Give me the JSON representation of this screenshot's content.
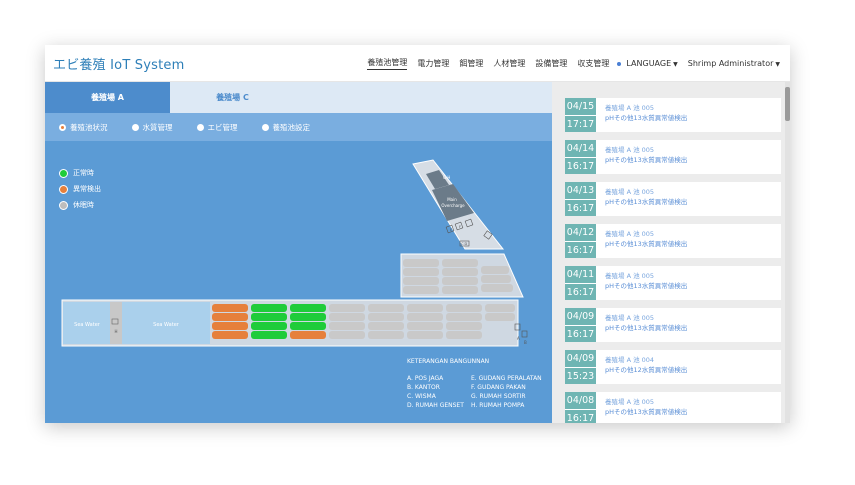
{
  "header": {
    "title": "エビ養殖 IoT System",
    "nav": [
      "養殖池管理",
      "電力管理",
      "餌管理",
      "人材管理",
      "設備管理",
      "収支管理"
    ],
    "active_nav": "養殖池管理",
    "language": "LANGUAGE",
    "user": "Shrimp Administrator"
  },
  "tabs": [
    {
      "label": "養殖場 A",
      "active": true
    },
    {
      "label": "養殖場 C",
      "active": false
    }
  ],
  "radios": [
    {
      "label": "養殖池状況",
      "selected": true
    },
    {
      "label": "水質管理",
      "selected": false
    },
    {
      "label": "エビ管理",
      "selected": false
    },
    {
      "label": "養殖池設定",
      "selected": false
    }
  ],
  "legend": [
    {
      "label": "正常時",
      "color": "#1fcc3a"
    },
    {
      "label": "異常検出",
      "color": "#e6803c"
    },
    {
      "label": "休眠時",
      "color": "#bdbdbd"
    }
  ],
  "map": {
    "sea_water_left": "Sea Water",
    "sea_water_right": "Sea Water",
    "pump_label": "H",
    "main_overcharge": [
      "Main",
      "Overcharge"
    ],
    "small_labels": [
      "G H",
      "E",
      "F",
      "C D",
      "A",
      "B"
    ]
  },
  "building_info": {
    "title": "KETERANGAN BANGUNNAN",
    "items": [
      "A. POS JAGA",
      "E. GUDANG PERALATAN",
      "B. KANTOR",
      "F. GUDANG PAKAN",
      "C. WISMA",
      "G. RUMAH SORTIR",
      "D. RUMAH GENSET",
      "H. RUMAH POMPA"
    ]
  },
  "colors": {
    "normal": "#1fcc3a",
    "abnormal": "#e6803c",
    "dormant": "#bdbdbd",
    "accent": "#6fb5b3",
    "map_bg": "#5b9bd5"
  },
  "notifications": [
    {
      "date": "04/15",
      "time": "17:17",
      "source": "養殖場 A 池 005",
      "message": "pHその他13水質異常値検出"
    },
    {
      "date": "04/14",
      "time": "16:17",
      "source": "養殖場 A 池 005",
      "message": "pHその他13水質異常値検出"
    },
    {
      "date": "04/13",
      "time": "16:17",
      "source": "養殖場 A 池 005",
      "message": "pHその他13水質異常値検出"
    },
    {
      "date": "04/12",
      "time": "16:17",
      "source": "養殖場 A 池 005",
      "message": "pHその他13水質異常値検出"
    },
    {
      "date": "04/11",
      "time": "16:17",
      "source": "養殖場 A 池 005",
      "message": "pHその他13水質異常値検出"
    },
    {
      "date": "04/09",
      "time": "16:17",
      "source": "養殖場 A 池 005",
      "message": "pHその他13水質異常値検出"
    },
    {
      "date": "04/09",
      "time": "15:23",
      "source": "養殖場 A 池 004",
      "message": "pHその他12水質異常値検出"
    },
    {
      "date": "04/08",
      "time": "16:17",
      "source": "養殖場 A 池 005",
      "message": "pHその他13水質異常値検出"
    }
  ]
}
